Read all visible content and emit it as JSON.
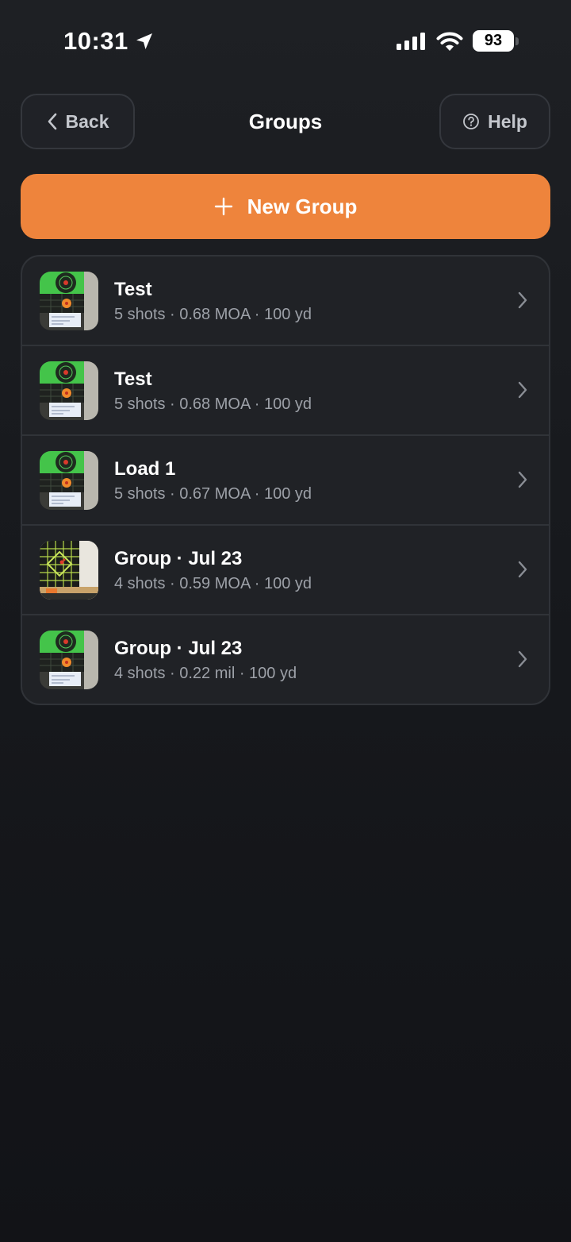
{
  "status_bar": {
    "time": "10:31",
    "battery": "93"
  },
  "header": {
    "back_label": "Back",
    "title": "Groups",
    "help_label": "Help"
  },
  "new_group": {
    "label": "New Group"
  },
  "groups": [
    {
      "title": "Test",
      "meta": "5 shots · 0.68 MOA · 100 yd",
      "thumb": "green-target"
    },
    {
      "title": "Test",
      "meta": "5 shots · 0.68 MOA · 100 yd",
      "thumb": "green-target"
    },
    {
      "title": "Load 1",
      "meta": "5 shots · 0.67 MOA · 100 yd",
      "thumb": "green-target"
    },
    {
      "title": "Group · Jul 23",
      "meta": "4 shots · 0.59 MOA · 100 yd",
      "thumb": "grid-target"
    },
    {
      "title": "Group · Jul 23",
      "meta": "4 shots · 0.22 mil · 100 yd",
      "thumb": "green-target"
    }
  ],
  "colors": {
    "accent": "#ee843c",
    "background": "#16181c",
    "card": "#202226"
  }
}
